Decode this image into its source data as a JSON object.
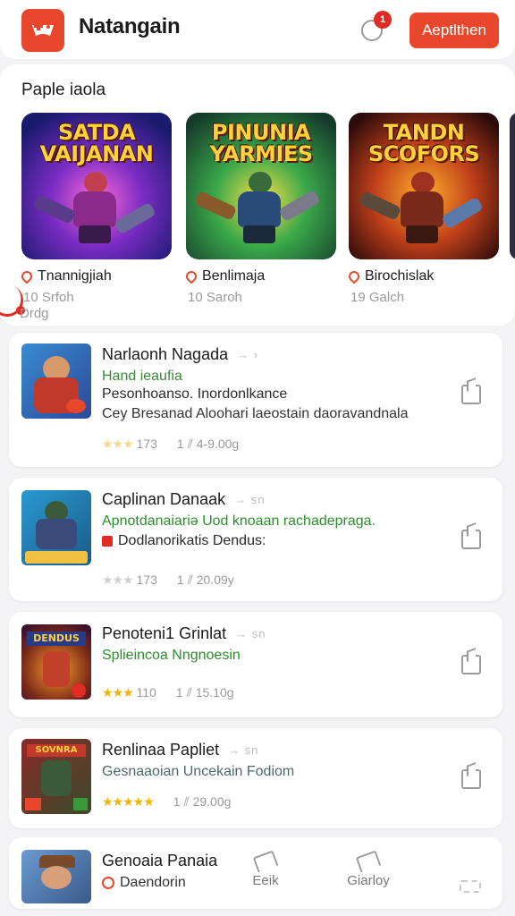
{
  "header": {
    "title": "Natangain",
    "notification_count": "1",
    "action_label": "Aeptlthen",
    "logo_icon": "gamepad-icon",
    "bell_icon": "bell-icon"
  },
  "featured": {
    "section_title": "Paple iaola",
    "side_label": "Drdg",
    "items": [
      {
        "art_title": "SATDA VAIJANAN",
        "name": "Tnannigjiah",
        "meta": "10 Srfoh"
      },
      {
        "art_title": "PINUNIA YARMIES",
        "name": "Benlimaja",
        "meta": "10 Saroh"
      },
      {
        "art_title": "TANDN SCOFORS",
        "name": "Birochislak",
        "meta": "19 Galch"
      }
    ]
  },
  "list": [
    {
      "title": "Narlaonh Nagada",
      "arrow": "→ ›",
      "line1": "Hand ieaufia",
      "line2": "Pesonhoanso. Inordonlkance",
      "line3": "Cey Bresanad Aloohari laeostain daoravandnala",
      "rating": "173",
      "installs": "1",
      "size": "4-9.00g",
      "stars": 3
    },
    {
      "title": "Caplinan Danaak",
      "arrow": "→ sn",
      "line1": "Apnotdanaiariə Uod knoaan rachadepraga.",
      "line2": "Dodlanorikatis Dendus:",
      "rating": "173",
      "installs": "1",
      "size": "20.09y",
      "stars": 3
    },
    {
      "title": "Penoteni1 Grinlat",
      "arrow": "→ sn",
      "line1": "Splieincoa Nngnoesin",
      "rating": "110",
      "installs": "1",
      "size": "15.10g",
      "stars": 3
    },
    {
      "title": "Renlinaa Papliet",
      "arrow": "→ sn",
      "line1": "Gesnaaoian Uncekain Fodiom",
      "rating": "",
      "installs": "1",
      "size": "29.00g",
      "stars": 5
    },
    {
      "title": "Genoaia Panaia",
      "line1": "Daendorin"
    }
  ],
  "bottom_nav": {
    "item1": "Eeik",
    "item2": "Giarloy"
  },
  "colors": {
    "accent": "#e8472b",
    "green_text": "#2a8f2a",
    "red_text": "#c0392b",
    "star": "#f0b400"
  }
}
